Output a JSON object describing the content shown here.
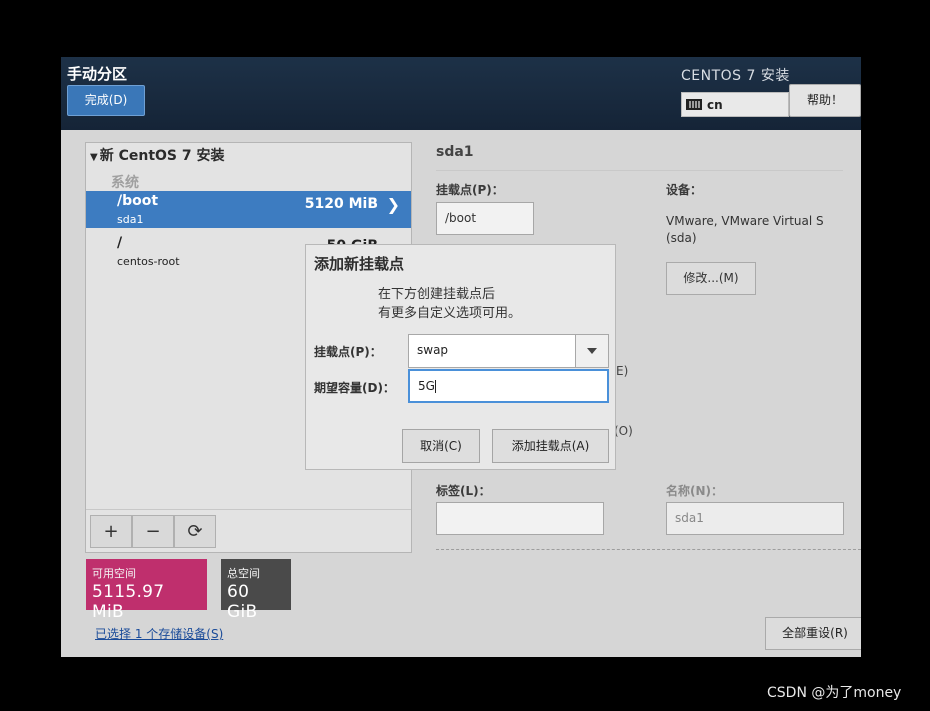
{
  "header": {
    "title": "手动分区",
    "done_label": "完成(D)",
    "product": "CENTOS 7 安装",
    "keyboard_layout": "cn",
    "help_label": "帮助！"
  },
  "tree": {
    "root_label": "新 CentOS 7 安装",
    "group_label": "系统",
    "partitions": [
      {
        "mount": "/boot",
        "device": "sda1",
        "size": "5120 MiB",
        "selected": true
      },
      {
        "mount": "/",
        "device": "centos-root",
        "size": "50 GiB",
        "selected": false
      }
    ]
  },
  "toolbar": {
    "add": "+",
    "remove": "−",
    "refresh": "⟳"
  },
  "space": {
    "available_label": "可用空间",
    "available_value": "5115.97 MiB",
    "total_label": "总空间",
    "total_value": "60 GiB"
  },
  "storage_link": "已选择 1 个存储设备(S)",
  "detail": {
    "title": "sda1",
    "mount_label": "挂载点(P)：",
    "mount_value": "/boot",
    "device_label": "设备：",
    "device_text": "VMware, VMware Virtual S (sda)",
    "modify_label": "修改...(M)",
    "partial_e": "E)",
    "partial_o": "(O)",
    "label_label": "标签(L)：",
    "name_label": "名称(N)：",
    "name_value": "sda1",
    "reset_label": "全部重设(R)"
  },
  "modal": {
    "title": "添加新挂载点",
    "message_line1": "在下方创建挂载点后",
    "message_line2": "有更多自定义选项可用。",
    "mount_label": "挂载点(P)：",
    "mount_value": "swap",
    "capacity_label": "期望容量(D)：",
    "capacity_value": "5G",
    "cancel_label": "取消(C)",
    "add_label": "添加挂载点(A)"
  },
  "watermark": "CSDN @为了money",
  "colors": {
    "header_bg": "#1d3147",
    "selection": "#3d7cc1",
    "available_space": "#bf2f6d",
    "total_space": "#4a4a4a",
    "focus_border": "#4a90d9"
  }
}
